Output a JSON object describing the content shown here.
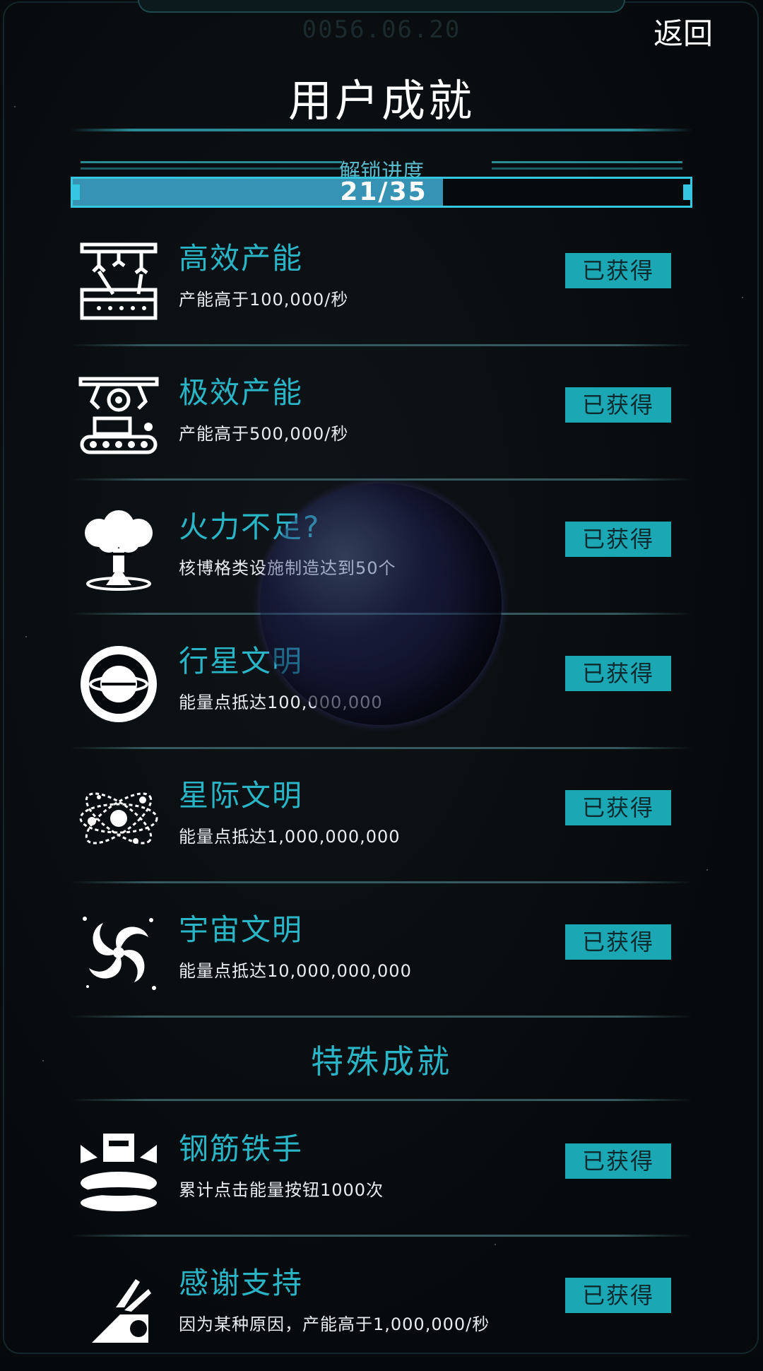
{
  "header": {
    "date": "0056.06.20",
    "back_label": "返回",
    "title": "用户成就"
  },
  "progress": {
    "label": "解锁进度",
    "text": "21/35",
    "unlocked": 21,
    "total": 35
  },
  "achievements": [
    {
      "name": "高效产能",
      "desc": "产能高于100,000/秒",
      "status": "已获得",
      "icon": "factory-robot-arm-icon"
    },
    {
      "name": "极效产能",
      "desc": "产能高于500,000/秒",
      "status": "已获得",
      "icon": "conveyor-gear-icon"
    },
    {
      "name": "火力不足?",
      "desc": "核博格类设施制造达到50个",
      "status": "已获得",
      "icon": "mushroom-cloud-icon"
    },
    {
      "name": "行星文明",
      "desc": "能量点抵达100,000,000",
      "status": "已获得",
      "icon": "ringed-planet-icon"
    },
    {
      "name": "星际文明",
      "desc": "能量点抵达1,000,000,000",
      "status": "已获得",
      "icon": "atom-orbit-icon"
    },
    {
      "name": "宇宙文明",
      "desc": "能量点抵达10,000,000,000",
      "status": "已获得",
      "icon": "galaxy-swirl-icon"
    }
  ],
  "special_section_title": "特殊成就",
  "special_achievements": [
    {
      "name": "钢筋铁手",
      "desc": "累计点击能量按钮1000次",
      "status": "已获得",
      "icon": "press-button-icon"
    },
    {
      "name": "感谢支持",
      "desc": "因为某种原因，产能高于1,000,000/秒",
      "status": "已获得",
      "icon": "hand-support-icon"
    }
  ],
  "colors": {
    "accent": "#2ab5c6",
    "button_bg": "#1ba7b4",
    "progress_fill": "#3793b3",
    "progress_border": "#35c7df",
    "background": "#06090c"
  }
}
